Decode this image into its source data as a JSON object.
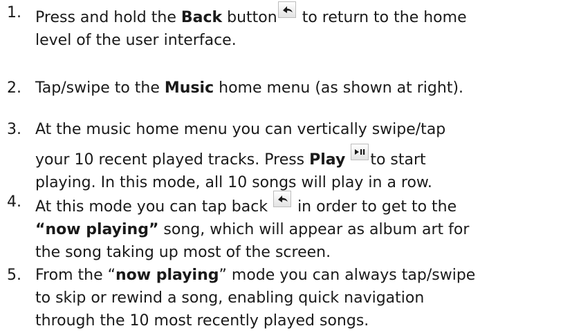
{
  "steps": [
    {
      "num": "1.",
      "a": "Press and hold the ",
      "b": "Back",
      "c": " button",
      "d": " to return to the home",
      "e": "level of the user interface."
    },
    {
      "num": "2.",
      "a": "Tap/swipe to the ",
      "b": "Music",
      "c": " home menu (as shown at right)."
    },
    {
      "num": "3.",
      "a": "At the music home menu you can vertically swipe/tap",
      "b": "your 10 recent played tracks.  Press ",
      "c": "Play",
      "d": "to start",
      "e": "playing.  In this mode, all 10 songs will play in a row."
    },
    {
      "num": "4.",
      "a": "At this mode you can tap back ",
      "b": " in order to get to the",
      "c": "“now playing”",
      "d": " song, which will appear as album art for",
      "e": "the song taking up most of the screen."
    },
    {
      "num": "5.",
      "a": "From the “",
      "b": "now playing",
      "c": "” mode you can always tap/swipe",
      "d": "to skip or rewind a song, enabling quick navigation",
      "e": "through the 10 most recently played songs."
    }
  ],
  "icons": {
    "back": "back-arrow-icon",
    "play": "play-pause-icon"
  }
}
